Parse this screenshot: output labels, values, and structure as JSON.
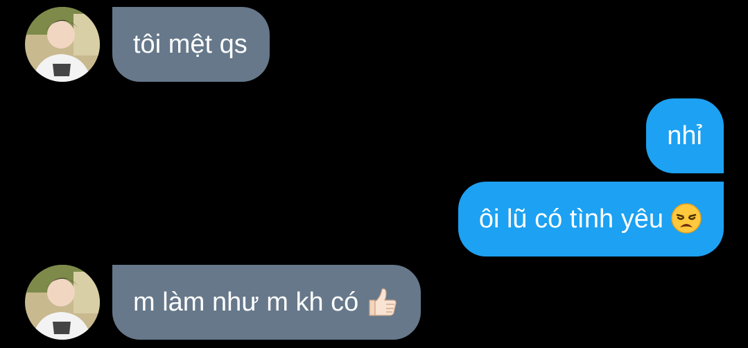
{
  "conversation": {
    "messages": [
      {
        "sender": "other",
        "text": "tôi mệt qs"
      },
      {
        "sender": "me",
        "text": "nhỉ"
      },
      {
        "sender": "me",
        "text": "ôi lũ có tình yêu",
        "emoji": "weary-face-emoji"
      },
      {
        "sender": "other",
        "text": "m làm như m kh có",
        "emoji": "thumbs-up-emoji"
      }
    ]
  },
  "colors": {
    "background": "#000000",
    "incoming_bubble": "#66788a",
    "outgoing_bubble": "#1da1f2",
    "text": "#ffffff"
  }
}
